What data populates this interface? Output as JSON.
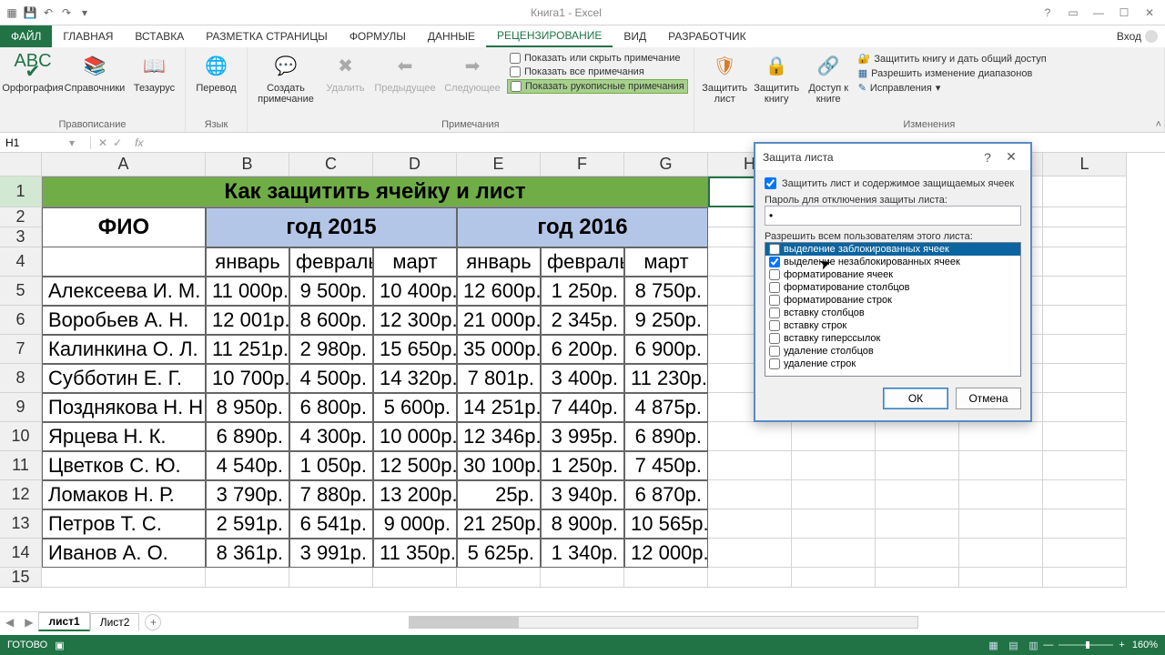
{
  "app": {
    "title": "Книга1 - Excel",
    "login": "Вход"
  },
  "tabs": {
    "file": "ФАЙЛ",
    "items": [
      "ГЛАВНАЯ",
      "ВСТАВКА",
      "РАЗМЕТКА СТРАНИЦЫ",
      "ФОРМУЛЫ",
      "ДАННЫЕ",
      "РЕЦЕНЗИРОВАНИЕ",
      "ВИД",
      "РАЗРАБОТЧИК"
    ],
    "active_index": 5
  },
  "ribbon": {
    "groups": {
      "proofing": {
        "label": "Правописание",
        "items": [
          "Орфография",
          "Справочники",
          "Тезаурус"
        ]
      },
      "language": {
        "label": "Язык",
        "items": [
          "Перевод"
        ]
      },
      "comments": {
        "label": "Примечания",
        "new": "Создать примечание",
        "delete": "Удалить",
        "prev": "Предыдущее",
        "next": "Следующее",
        "chk_showhide": "Показать или скрыть примечание",
        "chk_showall": "Показать все примечания",
        "chk_ink": "Показать рукописные примечания"
      },
      "protect": {
        "label": "Изменения",
        "sheet": "Защитить лист",
        "book": "Защитить книгу",
        "share": "Доступ к книге",
        "share_protect": "Защитить книгу и дать общий доступ",
        "allow_ranges": "Разрешить изменение диапазонов",
        "track": "Исправления"
      }
    }
  },
  "namebox": "H1",
  "columns": [
    "A",
    "B",
    "C",
    "D",
    "E",
    "F",
    "G",
    "H",
    "I",
    "J",
    "K",
    "L"
  ],
  "rows": [
    1,
    2,
    3,
    4,
    5,
    6,
    7,
    8,
    9,
    10,
    11,
    12,
    13,
    14,
    15
  ],
  "table": {
    "title": "Как защитить ячейку и лист",
    "fio": "ФИО",
    "year2015": "год 2015",
    "year2016": "год 2016",
    "months": [
      "январь",
      "февраль",
      "март",
      "январь",
      "февраль",
      "март"
    ],
    "data": [
      {
        "name": "Алексеева И. М.",
        "v": [
          "11 000р.",
          "9 500р.",
          "10 400р.",
          "12 600р.",
          "1 250р.",
          "8 750р."
        ]
      },
      {
        "name": "Воробьев А. Н.",
        "v": [
          "12 001р.",
          "8 600р.",
          "12 300р.",
          "21 000р.",
          "2 345р.",
          "9 250р."
        ]
      },
      {
        "name": "Калинкина О. Л.",
        "v": [
          "11 251р.",
          "2 980р.",
          "15 650р.",
          "35 000р.",
          "6 200р.",
          "6 900р."
        ]
      },
      {
        "name": "Субботин Е. Г.",
        "v": [
          "10 700р.",
          "4 500р.",
          "14 320р.",
          "7 801р.",
          "3 400р.",
          "11 230р."
        ]
      },
      {
        "name": "Позднякова Н. Н.",
        "v": [
          "8 950р.",
          "6 800р.",
          "5 600р.",
          "14 251р.",
          "7 440р.",
          "4 875р."
        ]
      },
      {
        "name": "Ярцева Н. К.",
        "v": [
          "6 890р.",
          "4 300р.",
          "10 000р.",
          "12 346р.",
          "3 995р.",
          "6 890р."
        ]
      },
      {
        "name": "Цветков С. Ю.",
        "v": [
          "4 540р.",
          "1 050р.",
          "12 500р.",
          "30 100р.",
          "1 250р.",
          "7 450р."
        ]
      },
      {
        "name": "Ломаков Н. Р.",
        "v": [
          "3 790р.",
          "7 880р.",
          "13 200р.",
          "25р.",
          "3 940р.",
          "6 870р."
        ]
      },
      {
        "name": "Петров Т. С.",
        "v": [
          "2 591р.",
          "6 541р.",
          "9 000р.",
          "21 250р.",
          "8 900р.",
          "10 565р."
        ]
      },
      {
        "name": "Иванов А. О.",
        "v": [
          "8 361р.",
          "3 991р.",
          "11 350р.",
          "5 625р.",
          "1 340р.",
          "12 000р."
        ]
      }
    ]
  },
  "sheets": {
    "tabs": [
      "лист1",
      "Лист2"
    ],
    "active": 0
  },
  "status": {
    "ready": "ГОТОВО",
    "zoom": "160%"
  },
  "dialog": {
    "title": "Защита листа",
    "protect_contents": "Защитить лист и содержимое защищаемых ячеек",
    "password_label": "Пароль для отключения защиты листа:",
    "password_value": "•",
    "allow_label": "Разрешить всем пользователям этого листа:",
    "perms": [
      {
        "label": "выделение заблокированных ячеек",
        "checked": false,
        "selected": true
      },
      {
        "label": "выделение незаблокированных ячеек",
        "checked": true
      },
      {
        "label": "форматирование ячеек",
        "checked": false
      },
      {
        "label": "форматирование столбцов",
        "checked": false
      },
      {
        "label": "форматирование строк",
        "checked": false
      },
      {
        "label": "вставку столбцов",
        "checked": false
      },
      {
        "label": "вставку строк",
        "checked": false
      },
      {
        "label": "вставку гиперссылок",
        "checked": false
      },
      {
        "label": "удаление столбцов",
        "checked": false
      },
      {
        "label": "удаление строк",
        "checked": false
      }
    ],
    "ok": "ОК",
    "cancel": "Отмена"
  }
}
